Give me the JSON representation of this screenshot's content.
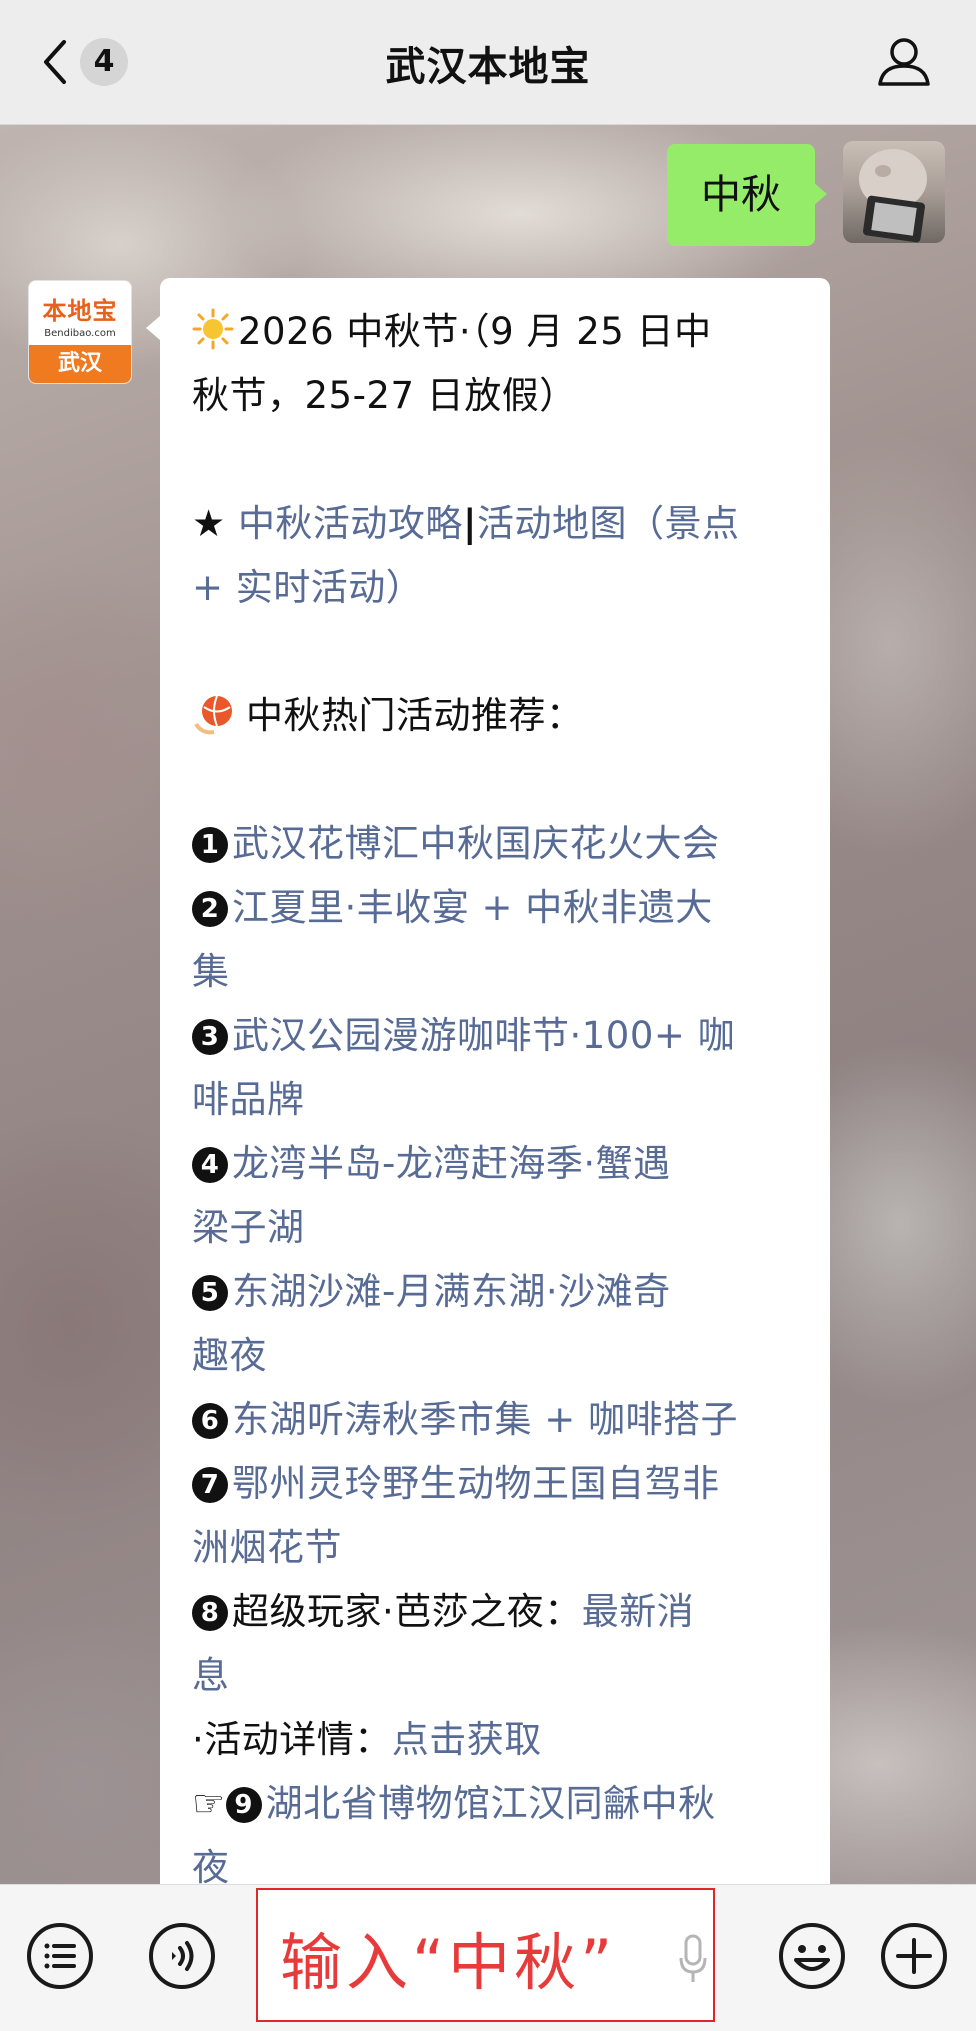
{
  "header": {
    "back_count": "4",
    "title": "武汉本地宝"
  },
  "outgoing": {
    "text": "中秋"
  },
  "incoming_avatar": {
    "logo": "本地宝",
    "sub": "Bendibao.com",
    "city": "武汉"
  },
  "message": {
    "line1": "2026 中秋节·（9 月 25 日中",
    "line2": "秋节，25-27 日放假）",
    "star": "★ ",
    "guide_link": "中秋活动攻略",
    "sep": "|",
    "map_link_1": "活动地图（景点",
    "map_link_2": "+ 实时活动）",
    "hot_title": "中秋热门活动推荐：",
    "items": [
      {
        "num": "1",
        "l1": "武汉花博汇中秋国庆花火大会",
        "l2": ""
      },
      {
        "num": "2",
        "l1": "江夏里·丰收宴 + 中秋非遗大",
        "l2": "集"
      },
      {
        "num": "3",
        "l1": "武汉公园漫游咖啡节·100+ 咖",
        "l2": "啡品牌"
      },
      {
        "num": "4",
        "l1": "龙湾半岛-龙湾赶海季·蟹遇",
        "l2": "梁子湖"
      },
      {
        "num": "5",
        "l1": "东湖沙滩-月满东湖·沙滩奇",
        "l2": "趣夜"
      },
      {
        "num": "6",
        "l1": "东湖听涛秋季市集 + 咖啡搭子",
        "l2": ""
      },
      {
        "num": "7",
        "l1": "鄂州灵玲野生动物王国自驾非",
        "l2": "洲烟花节"
      }
    ],
    "item8_num": "8",
    "item8_plain": "超级玩家·芭莎之夜：",
    "item8_link1": "最新消",
    "item8_link2": "息",
    "detail_plain": "·活动详情：",
    "detail_link": "点击获取",
    "item9_hand": "☞",
    "item9_num": "9",
    "item9_l1": "湖北省博物馆江汉同龢中秋",
    "item9_l2": "夜"
  },
  "input": {
    "text": "输入“中秋”"
  },
  "icons": {
    "back": "chevron-left-icon",
    "profile": "person-icon",
    "menu": "list-menu-icon",
    "voice": "voice-icon",
    "mic": "microphone-icon",
    "emoji": "emoji-icon",
    "plus": "plus-icon"
  }
}
